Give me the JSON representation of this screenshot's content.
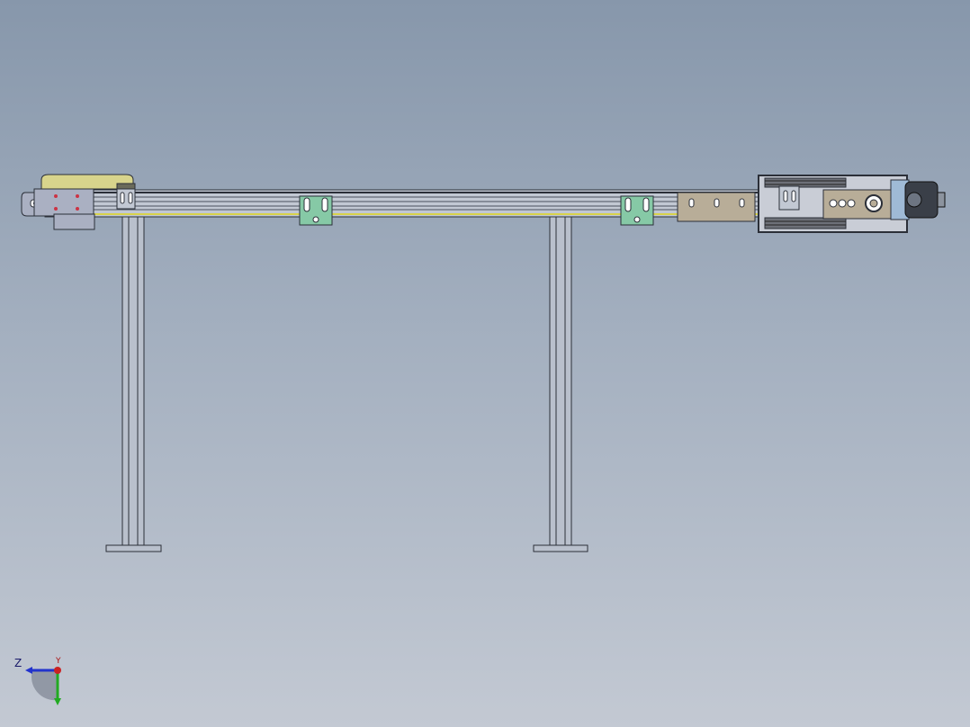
{
  "viewport": {
    "background_top": "#8797ab",
    "background_bottom": "#c3c9d3"
  },
  "model": {
    "description_icons": [
      "conveyor-frame",
      "support-leg",
      "mounting-bracket",
      "drive-motor",
      "idler-end"
    ],
    "colors": {
      "profile": "#b9c0cc",
      "profile_edge": "#2b2f38",
      "belt": "#d8d24a",
      "bracket_green": "#86c9a6",
      "drive_plate": "#b8ad98",
      "motor_blue": "#9fbad6",
      "motor_dark": "#3a3f48",
      "idler_plate": "#aab0c2",
      "idler_yellow": "#d8d48c"
    }
  },
  "triad": {
    "z_label": "Z",
    "y_label": "Y",
    "colors": {
      "z": "#2233cc",
      "y": "#22aa22",
      "x": "#cc2222"
    }
  }
}
